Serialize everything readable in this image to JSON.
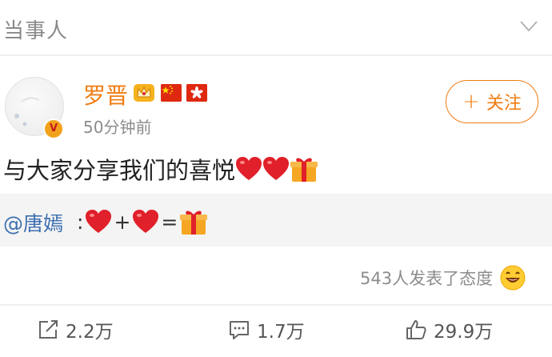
{
  "header": {
    "title": "当事人"
  },
  "post": {
    "author": "罗晋",
    "timestamp": "50分钟前",
    "follow_label": "关注",
    "text": "与大家分享我们的喜悦",
    "quote": {
      "mention": "@唐嫣",
      "colon": ":",
      "plus": "+",
      "equals": "="
    },
    "reactions_text": "543人发表了态度"
  },
  "actions": {
    "repost_count": "2.2万",
    "comment_count": "1.7万",
    "like_count": "29.9万"
  },
  "colors": {
    "accent": "#f07c12",
    "link": "#3b6fb0",
    "heart": "#e0202a"
  },
  "icons": {
    "chevron": "chevron-down-icon",
    "crown": "crown-icon",
    "repost": "repost-icon",
    "comment": "comment-icon",
    "like": "like-icon"
  }
}
